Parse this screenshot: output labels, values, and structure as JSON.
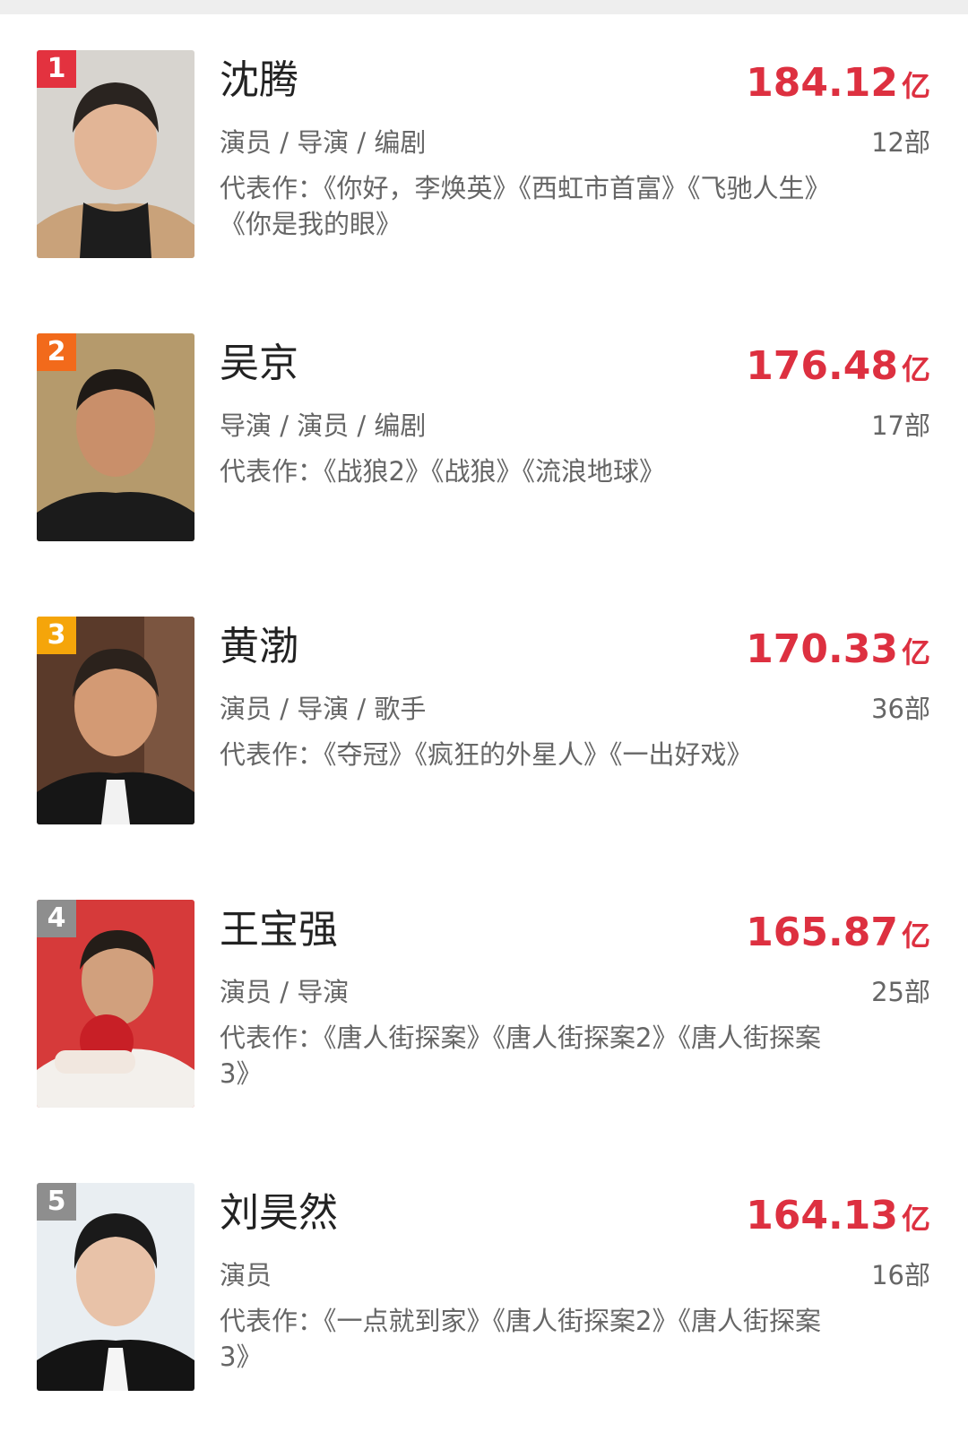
{
  "colors": {
    "amount_red": "#dd3040",
    "rank_1": "#e3323f",
    "rank_2": "#f26a1b",
    "rank_3": "#f5a50a",
    "rank_other": "#8e8e8e"
  },
  "ranking": [
    {
      "rank": "1",
      "name": "沈腾",
      "amount": "184.12",
      "unit": "亿",
      "roles": "演员 / 导演 / 编剧",
      "count": "12部",
      "works": "代表作：《你好，李焕英》《西虹市首富》《飞驰人生》《你是我的眼》",
      "photo_icon": "portrait-photo-icon"
    },
    {
      "rank": "2",
      "name": "吴京",
      "amount": "176.48",
      "unit": "亿",
      "roles": "导演 / 演员 / 编剧",
      "count": "17部",
      "works": "代表作：《战狼2》《战狼》《流浪地球》",
      "photo_icon": "portrait-photo-icon"
    },
    {
      "rank": "3",
      "name": "黄渤",
      "amount": "170.33",
      "unit": "亿",
      "roles": "演员 / 导演 / 歌手",
      "count": "36部",
      "works": "代表作：《夺冠》《疯狂的外星人》《一出好戏》",
      "photo_icon": "portrait-photo-icon"
    },
    {
      "rank": "4",
      "name": "王宝强",
      "amount": "165.87",
      "unit": "亿",
      "roles": "演员 / 导演",
      "count": "25部",
      "works": "代表作：《唐人街探案》《唐人街探案2》《唐人街探案3》",
      "photo_icon": "portrait-photo-icon"
    },
    {
      "rank": "5",
      "name": "刘昊然",
      "amount": "164.13",
      "unit": "亿",
      "roles": "演员",
      "count": "16部",
      "works": "代表作：《一点就到家》《唐人街探案2》《唐人街探案3》",
      "photo_icon": "portrait-photo-icon"
    }
  ]
}
